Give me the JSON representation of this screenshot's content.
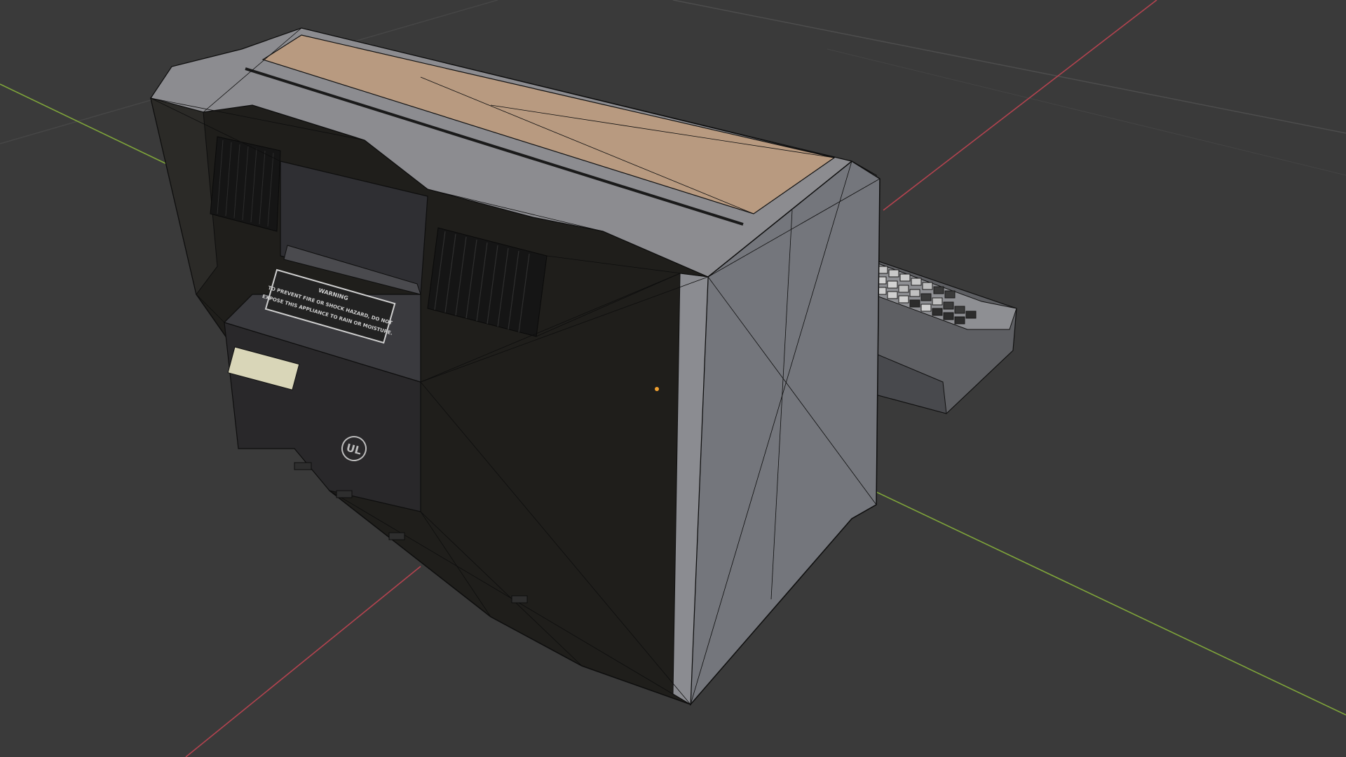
{
  "viewport": {
    "background_color": "#3a3a3a",
    "grid_line_color": "#4a4a4a",
    "x_axis_color": "#b3434f",
    "y_axis_color": "#7fa53a"
  },
  "model": {
    "name": "crt-monitor-with-keyboard",
    "shading": "solid-with-wireframe",
    "top_panel_color": "#b89a80",
    "casing_light_color": "#9a9a9e",
    "casing_dark_color": "#1f1e1b",
    "side_panel_color": "#74767c",
    "wire_color": "#0e0e0e"
  },
  "label": {
    "warning_heading": "WARNING",
    "warning_line1": "TO PREVENT FIRE OR SHOCK HAZARD, DO NOT",
    "warning_line2": "EXPOSE THIS APPLIANCE TO RAIN OR MOISTURE.",
    "ul_mark": "UL"
  },
  "origin_marker": {
    "color": "#f0a030"
  }
}
